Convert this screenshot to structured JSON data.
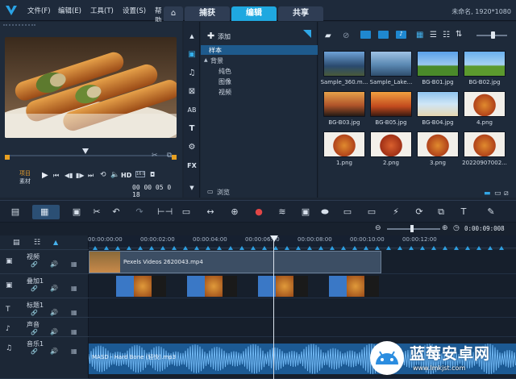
{
  "titlebar": {
    "menus": [
      "文件(F)",
      "编辑(E)",
      "工具(T)",
      "设置(S)",
      "帮助"
    ],
    "home_tab": "⌂",
    "tabs": [
      "捕获",
      "编辑",
      "共享"
    ],
    "active_tab": "编辑",
    "project_info": "未命名, 1920*1080"
  },
  "preview": {
    "mode_project": "项目",
    "mode_clip": "素材",
    "timecode": "00 00 05 0 18",
    "hd": "HD"
  },
  "library": {
    "add_label": "添加",
    "tree": {
      "root": "样本",
      "group": "背景",
      "children": [
        "纯色",
        "图像",
        "视频"
      ]
    },
    "browse": "浏览",
    "items": [
      {
        "label": "Sample_360.m...",
        "type": "sky"
      },
      {
        "label": "Sample_Lake...",
        "type": "lake"
      },
      {
        "label": "BG-B01.jpg",
        "type": "field"
      },
      {
        "label": "BG-B02.jpg",
        "type": "field2"
      },
      {
        "label": "BG-B03.jpg",
        "type": "tree"
      },
      {
        "label": "BG-B05.jpg",
        "type": "sunset"
      },
      {
        "label": "BG-B04.jpg",
        "type": "beach"
      },
      {
        "label": "4.png",
        "type": "food"
      },
      {
        "label": "1.png",
        "type": "food"
      },
      {
        "label": "2.png",
        "type": "food2"
      },
      {
        "label": "3.png",
        "type": "food"
      },
      {
        "label": "20220907002...",
        "type": "food"
      }
    ]
  },
  "timeline": {
    "total_time": "0:00:09:008",
    "ruler": [
      "00:00:00:00",
      "00:00:02:00",
      "00:00:04:00",
      "00:00:06:00",
      "00:00:08:00",
      "00:00:10:00",
      "00:00:12:00"
    ],
    "tracks": [
      {
        "name": "视频"
      },
      {
        "name": "叠加1"
      },
      {
        "name": "标题1"
      },
      {
        "name": "声音"
      },
      {
        "name": "音乐1"
      }
    ],
    "video_clip": "Pexels Videos 2620043.mp4",
    "music_clip": "MASD - Hard Bone (轻快).mp3"
  },
  "watermark": {
    "title": "蓝莓安卓网",
    "url": "www.lmkjst.com"
  }
}
